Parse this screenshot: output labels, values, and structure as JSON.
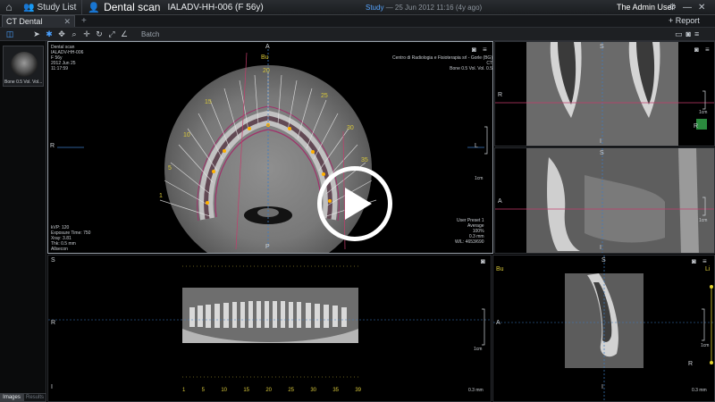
{
  "topbar": {
    "home_icon": "home-icon",
    "study_list_label": "Study List",
    "patient_icon": "user-icon",
    "modality_label": "Dental scan",
    "patient_id": "IALADV-HH-006 (F 56y)",
    "study_label": "Study",
    "study_date": "— 25 Jun 2012 11:16 (4y ago)",
    "user": "The Admin User",
    "report_label": "+ Report"
  },
  "tabs": {
    "active_tab": "CT Dental",
    "plus": "+"
  },
  "toolbar": {
    "batch_label": "Batch"
  },
  "left_panel": {
    "thumb_label": "Bone 0.5  Vol. Vol...",
    "tab_images": "Images",
    "tab_results": "Results"
  },
  "axial": {
    "info_tl": [
      "Dental scan",
      "IALADV-HH-006",
      "F 56y",
      "2012 Jun 25",
      "11:17:59"
    ],
    "info_tr": [
      "Centro di Radiologia e Fisioterapia srl - Gorle (BG)",
      "CT",
      "Bone 0.5   Vol.   Vol. 0.5"
    ],
    "info_bl": [
      "kVP: 120",
      "Exposure Time: 750",
      "Xray: 3.81",
      "Thk: 0.5 mm",
      "Allsecon"
    ],
    "info_br": [
      "User Preset 1",
      "Average",
      "100%",
      "0.3 mm",
      "W/L: 4653/690"
    ],
    "orient_top": "A",
    "orient_left": "R",
    "orient_right": "L",
    "orient_bottom": "P",
    "orient_bu": "Bu",
    "scale": "1cm",
    "panoramic_numbers": [
      "1",
      "5",
      "10",
      "15",
      "20",
      "25",
      "30",
      "35"
    ]
  },
  "cross1": {
    "top": "S",
    "left": "R",
    "bottom": "I",
    "scale": "1cm",
    "mark": "R"
  },
  "cross2": {
    "top": "S",
    "left": "A",
    "bottom": "I",
    "scale": "1cm"
  },
  "panoramic": {
    "top": "S",
    "left": "R",
    "bottom": "I",
    "scale": "1cm",
    "scale_value": "0.3 mm",
    "ruler": [
      "1",
      "5",
      "10",
      "15",
      "20",
      "25",
      "30",
      "35",
      "39"
    ]
  },
  "sagittal": {
    "top": "S",
    "left": "A",
    "bottom": "I",
    "bu": "Bu",
    "li": "Li",
    "scale": "1cm",
    "scale_value": "0.3 mm",
    "mark": "R"
  },
  "play_overlay": {
    "icon": "play-icon"
  }
}
